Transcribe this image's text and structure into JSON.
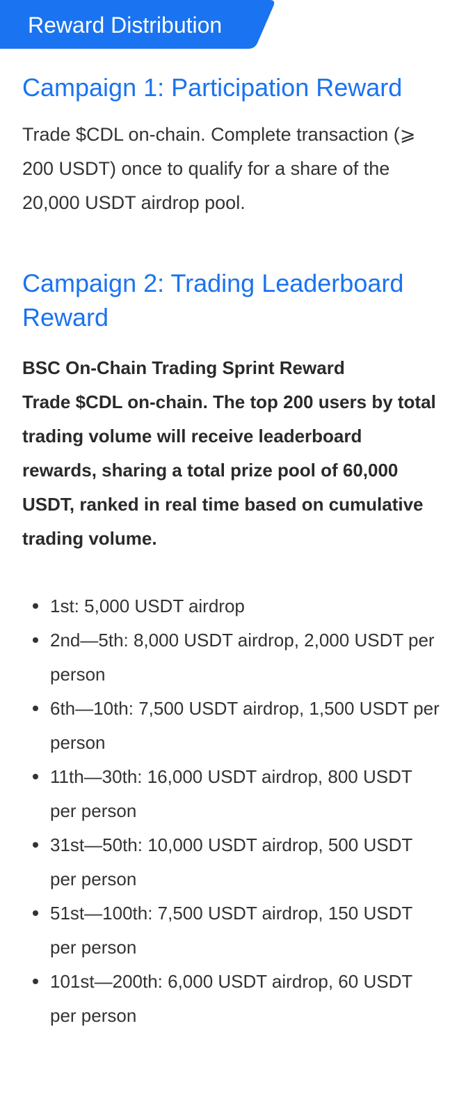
{
  "header": {
    "title": "Reward Distribution",
    "accent_color": "#1a73f0"
  },
  "campaign1": {
    "title": "Campaign 1: Participation Reward",
    "description": "Trade $CDL on-chain. Complete transaction (⩾ 200 USDT) once to qualify for a share of the 20,000 USDT airdrop pool."
  },
  "campaign2": {
    "title": "Campaign 2: Trading Leaderboard Reward",
    "subtitle": "BSC On-Chain Trading Sprint Reward",
    "description": "Trade $CDL on-chain. The top 200 users by total trading volume will receive leaderboard rewards, sharing a total prize pool of 60,000 USDT, ranked in real time based on cumulative trading volume.",
    "rewards": [
      "1st: 5,000 USDT airdrop",
      "2nd—5th: 8,000 USDT airdrop, 2,000 USDT per person",
      "6th—10th: 7,500  USDT airdrop, 1,500 USDT per person",
      "11th—30th: 16,000 USDT airdrop, 800 USDT per person",
      "31st—50th: 10,000 USDT airdrop, 500 USDT per person",
      "51st—100th: 7,500 USDT airdrop, 150 USDT per person",
      "101st—200th: 6,000 USDT airdrop, 60 USDT per person"
    ]
  }
}
